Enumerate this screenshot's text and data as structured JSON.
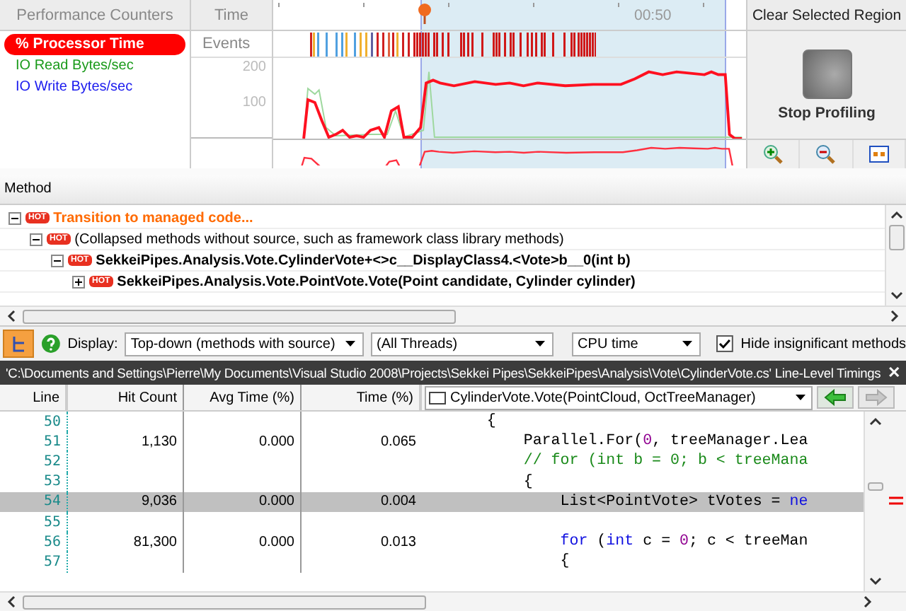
{
  "counters": {
    "title": "Performance Counters",
    "items": [
      {
        "label": "% Processor Time",
        "selected": true,
        "color": "#ff0000"
      },
      {
        "label": "IO Read Bytes/sec",
        "selected": false,
        "color": "#1a9a1a"
      },
      {
        "label": "IO Write Bytes/sec",
        "selected": false,
        "color": "#1a1aee"
      }
    ]
  },
  "timeline": {
    "time_label": "Time",
    "events_label": "Events",
    "axis_label": "00:50",
    "yticks": [
      "200",
      "100"
    ]
  },
  "clear_button": "Clear Selected Region",
  "stop_button": "Stop Profiling",
  "method_header": "Method",
  "tree": [
    {
      "kind": "transition",
      "badge": "HOT",
      "label": "Transition to managed code...",
      "expanded": true,
      "children": [
        {
          "kind": "collapsed",
          "badge": "HOT",
          "label": "(Collapsed methods without source, such as framework class library methods)",
          "expanded": true,
          "children": [
            {
              "kind": "method",
              "badge": "HOT",
              "label": "SekkeiPipes.Analysis.Vote.CylinderVote+<>c__DisplayClass4.<Vote>b__0(int b)",
              "expanded": true,
              "children": [
                {
                  "kind": "method",
                  "badge": "HOT",
                  "label": "SekkeiPipes.Analysis.Vote.PointVote.Vote(Point candidate, Cylinder cylinder)",
                  "expanded": false
                }
              ]
            }
          ]
        }
      ]
    }
  ],
  "toolbar": {
    "display_label": "Display:",
    "display": "Top-down (methods with source)",
    "threads": "(All Threads)",
    "metric": "CPU time",
    "hide_label": "Hide insignificant methods",
    "hide_checked": true
  },
  "file_bar": {
    "path": "'C:\\Documents and Settings\\Pierre\\My Documents\\Visual Studio 2008\\Projects\\Sekkei Pipes\\SekkeiPipes\\Analysis\\Vote\\CylinderVote.cs' Line-Level Timings",
    "close": "✕"
  },
  "table": {
    "columns": [
      "Line",
      "Hit Count",
      "Avg Time (%)",
      "Time (%)"
    ],
    "method": "CylinderVote.Vote(PointCloud, OctTreeManager)",
    "nav": [
      {
        "disabled": false
      },
      {
        "disabled": true
      }
    ],
    "rows": [
      {
        "line": "50",
        "selected": false,
        "code": [
          {
            "kind": "plain",
            "text": "    {"
          }
        ]
      },
      {
        "line": "51",
        "hit_count": "1,130",
        "avg_time": "0.000",
        "time": "0.065",
        "selected": false,
        "code": [
          {
            "kind": "plain",
            "text": "        Parallel.For("
          },
          {
            "kind": "number",
            "text": "0"
          },
          {
            "kind": "plain",
            "text": ", treeManager.Lea"
          }
        ]
      },
      {
        "line": "52",
        "selected": false,
        "code": [
          {
            "kind": "comment",
            "text": "        // for (int b = 0; b < treeMana"
          }
        ]
      },
      {
        "line": "53",
        "selected": false,
        "code": [
          {
            "kind": "plain",
            "text": "        {"
          }
        ]
      },
      {
        "line": "54",
        "hit_count": "9,036",
        "avg_time": "0.000",
        "time": "0.004",
        "selected": true,
        "code": [
          {
            "kind": "plain",
            "text": "            List<PointVote> tVotes = "
          },
          {
            "kind": "keyword",
            "text": "ne"
          }
        ]
      },
      {
        "line": "55",
        "selected": false
      },
      {
        "line": "56",
        "hit_count": "81,300",
        "avg_time": "0.000",
        "time": "0.013",
        "selected": false,
        "code": [
          {
            "kind": "keyword",
            "text": "            for"
          },
          {
            "kind": "plain",
            "text": " ("
          },
          {
            "kind": "keyword",
            "text": "int"
          },
          {
            "kind": "plain",
            "text": " c = "
          },
          {
            "kind": "number",
            "text": "0"
          },
          {
            "kind": "plain",
            "text": "; c < treeMan"
          }
        ]
      },
      {
        "line": "57",
        "selected": false,
        "code": [
          {
            "kind": "plain",
            "text": "            {"
          }
        ]
      }
    ]
  }
}
